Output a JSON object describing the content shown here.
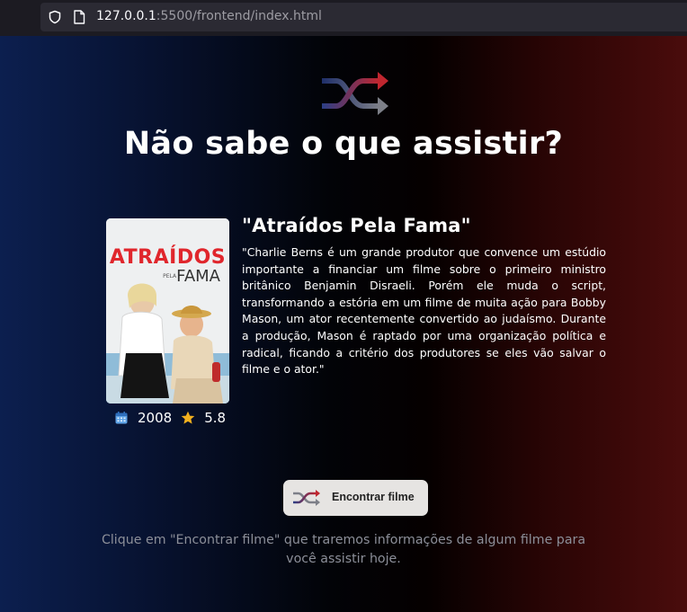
{
  "browser": {
    "url_host": "127.0.0.1",
    "url_rest": ":5500/frontend/index.html"
  },
  "page": {
    "title": "Não sabe o que assistir?",
    "icon": "shuffle-icon"
  },
  "movie": {
    "title": "\"Atraídos Pela Fama\"",
    "poster_title_line1": "ATRAÍDOS",
    "poster_title_small": "PELA",
    "poster_title_line2": "FAMA",
    "synopsis": "\"Charlie Berns é um grande produtor que convence um estúdio importante a financiar um filme sobre o primeiro ministro britânico Benjamin Disraeli. Porém ele muda o script, transformando a estória em um filme de muita ação para Bobby Mason, um ator recentemente convertido ao judaísmo. Durante a produção, Mason é raptado por uma organização política e radical, ficando a critério dos produtores se eles vão salvar o filme e o ator.\"",
    "year": "2008",
    "rating": "5.8",
    "year_icon": "calendar-icon",
    "rating_icon": "star-icon"
  },
  "actions": {
    "find_label": "Encontrar filme",
    "hint": "Clique em \"Encontrar filme\" que traremos informações de algum filme para você assistir hoje."
  },
  "colors": {
    "gradient_left": "#0c1f4f",
    "gradient_right": "#4a0c0c",
    "shuffle_red": "#c0262f",
    "shuffle_blue": "#2b3f86",
    "star": "#f2b01e",
    "button_bg": "#e6e4e2"
  }
}
